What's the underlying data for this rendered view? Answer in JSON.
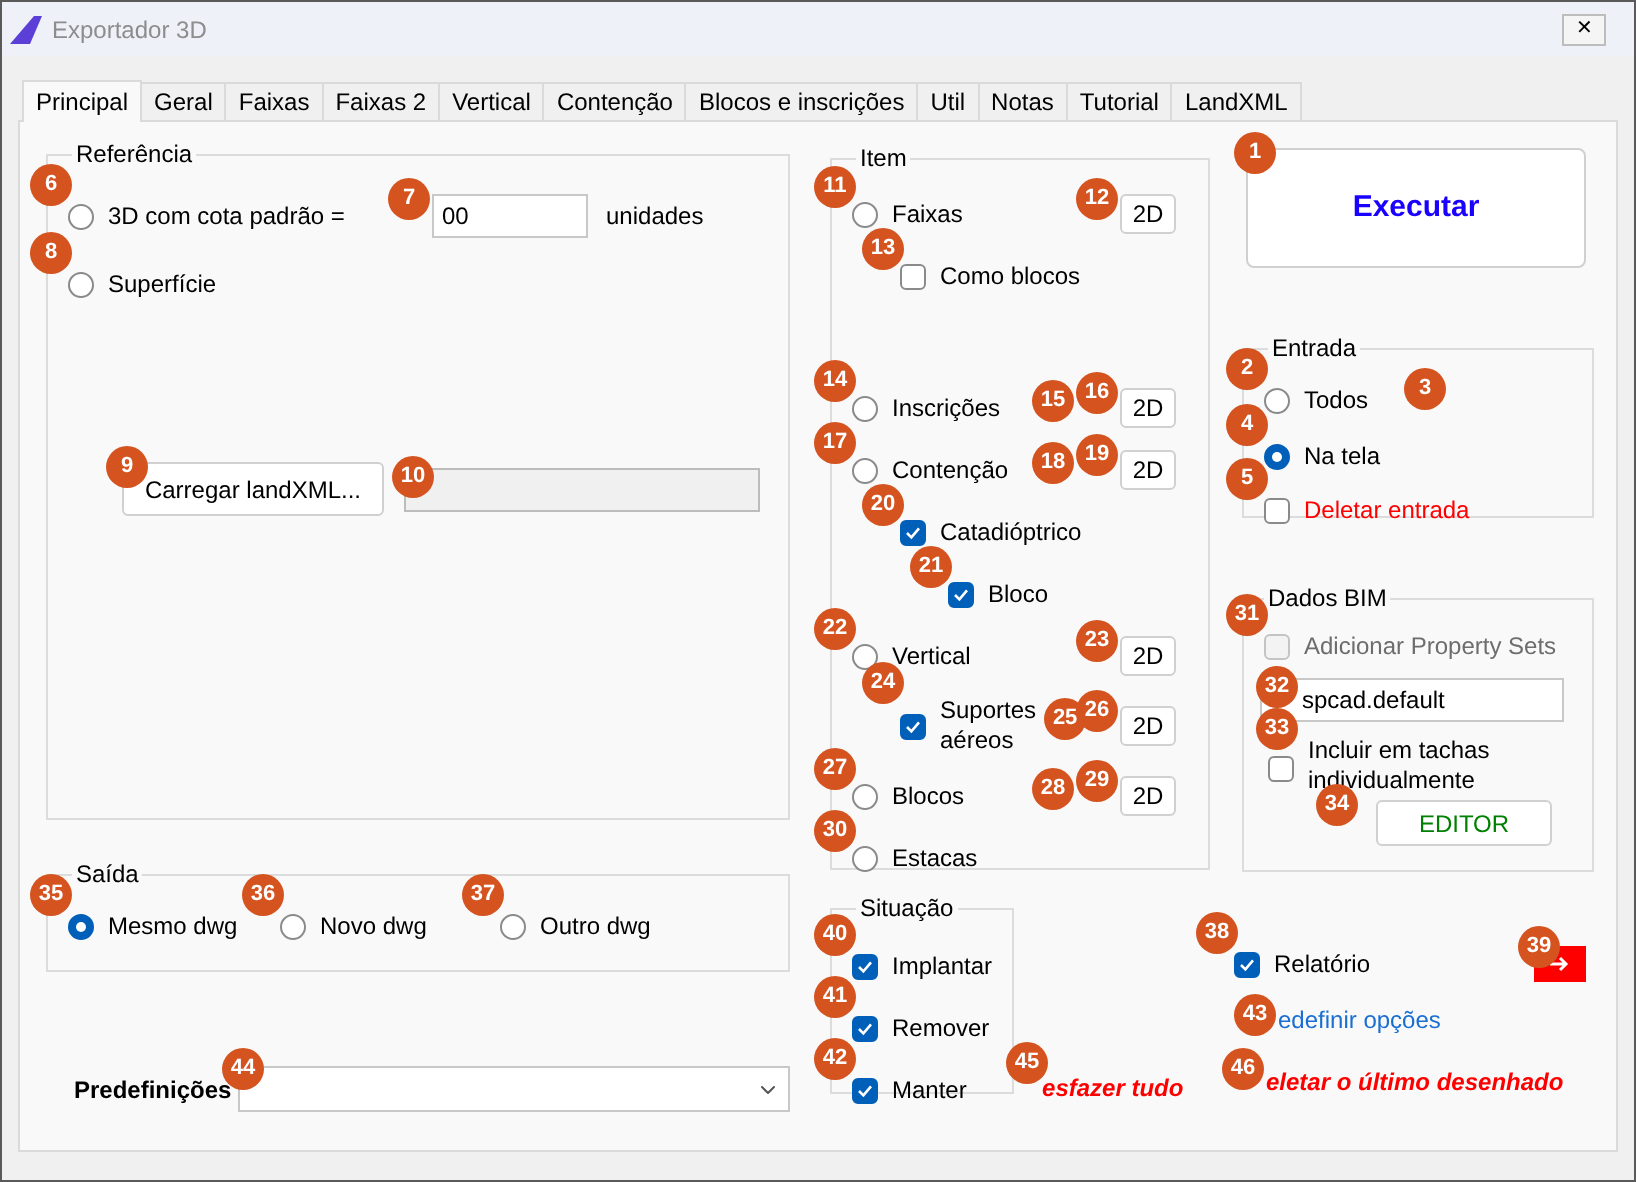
{
  "window": {
    "title": "Exportador 3D",
    "close": "✕"
  },
  "tabs": [
    {
      "label": "Principal",
      "selected": true
    },
    {
      "label": "Geral",
      "selected": false
    },
    {
      "label": "Faixas",
      "selected": false
    },
    {
      "label": "Faixas 2",
      "selected": false
    },
    {
      "label": "Vertical",
      "selected": false
    },
    {
      "label": "Contenção",
      "selected": false
    },
    {
      "label": "Blocos e inscrições",
      "selected": false
    },
    {
      "label": "Util",
      "selected": false
    },
    {
      "label": "Notas",
      "selected": false
    },
    {
      "label": "Tutorial",
      "selected": false
    },
    {
      "label": "LandXML",
      "selected": false
    }
  ],
  "referencia": {
    "title": "Referência",
    "options": [
      {
        "label": "3D com cota padrão =",
        "selected": false,
        "badge": "6"
      },
      {
        "label": "Superfície",
        "selected": false,
        "badge": "8"
      }
    ],
    "height_field": {
      "value": "00",
      "badge": "7"
    },
    "units": "unidades",
    "load_button": {
      "label": "Carregar landXML...",
      "badge": "9"
    },
    "file_field": {
      "badge": "10"
    }
  },
  "saida": {
    "title": "Saída",
    "options": [
      {
        "label": "Mesmo dwg",
        "selected": true,
        "badge": "35"
      },
      {
        "label": "Novo dwg",
        "selected": false,
        "badge": "36"
      },
      {
        "label": "Outro dwg",
        "selected": false,
        "badge": "37"
      }
    ]
  },
  "predefinicoes": {
    "label": "Predefinições",
    "badge": "44"
  },
  "item": {
    "title": "Item",
    "items": [
      {
        "kind": "radio",
        "label": "Faixas",
        "checked": false,
        "badge": "11",
        "mode": {
          "label": "2D",
          "badge": "12"
        },
        "children": [
          {
            "kind": "checkbox",
            "label": "Como blocos",
            "checked": false,
            "badge": "13"
          }
        ]
      },
      {
        "kind": "radio",
        "label": "Inscrições",
        "checked": false,
        "badge": "14",
        "extra_badge": "15",
        "mode": {
          "label": "2D",
          "badge": "16"
        }
      },
      {
        "kind": "radio",
        "label": "Contenção",
        "checked": false,
        "badge": "17",
        "extra_badge": "18",
        "mode": {
          "label": "2D",
          "badge": "19"
        },
        "children": [
          {
            "kind": "checkbox",
            "label": "Catadióptrico",
            "checked": true,
            "badge": "20",
            "children": [
              {
                "kind": "checkbox",
                "label": "Bloco",
                "checked": true,
                "badge": "21"
              }
            ]
          }
        ]
      },
      {
        "kind": "radio",
        "label": "Vertical",
        "checked": false,
        "badge": "22",
        "mode": {
          "label": "2D",
          "badge": "23"
        },
        "children": [
          {
            "kind": "checkbox",
            "label": "Suportes aéreos",
            "checked": true,
            "badge": "24",
            "extra_badge": "25",
            "mode": {
              "label": "2D",
              "badge": "26"
            }
          }
        ]
      },
      {
        "kind": "radio",
        "label": "Blocos",
        "checked": false,
        "badge": "27",
        "extra_badge": "28",
        "mode": {
          "label": "2D",
          "badge": "29"
        }
      },
      {
        "kind": "radio",
        "label": "Estacas",
        "checked": false,
        "badge": "30"
      }
    ]
  },
  "situacao": {
    "title": "Situação",
    "items": [
      {
        "label": "Implantar",
        "checked": true,
        "badge": "40"
      },
      {
        "label": "Remover",
        "checked": true,
        "badge": "41"
      },
      {
        "label": "Manter",
        "checked": true,
        "badge": "42"
      }
    ]
  },
  "executar": {
    "label": "Executar",
    "badge": "1"
  },
  "entrada": {
    "title": "Entrada",
    "items": [
      {
        "kind": "radio",
        "label": "Todos",
        "checked": false,
        "badge": "2",
        "extra_badge": "3"
      },
      {
        "kind": "radio",
        "label": "Na tela",
        "checked": true,
        "badge": "4"
      },
      {
        "kind": "checkbox",
        "label": "Deletar entrada",
        "checked": false,
        "badge": "5",
        "color": "#ff0000"
      }
    ]
  },
  "bim": {
    "title": "Dados BIM",
    "add_sets": {
      "label": "Adicionar Property Sets",
      "checked": false,
      "disabled": true,
      "badge": "31"
    },
    "field": {
      "value": "spcad.default",
      "badge": "32"
    },
    "include": {
      "label": "Incluir em tachas individualmente",
      "checked": false,
      "badge": "33"
    },
    "editor": {
      "label": "EDITOR",
      "badge": "34"
    }
  },
  "relatorio": {
    "label": "Relatório",
    "checked": true,
    "badge": "38"
  },
  "export_button": {
    "badge": "39"
  },
  "redefinir": {
    "label": "edefinir opções",
    "badge": "43"
  },
  "desfazer": {
    "label": "esfazer tudo",
    "badge": "45"
  },
  "deletar_ultimo": {
    "label": "eletar o último desenhado",
    "badge": "46"
  }
}
